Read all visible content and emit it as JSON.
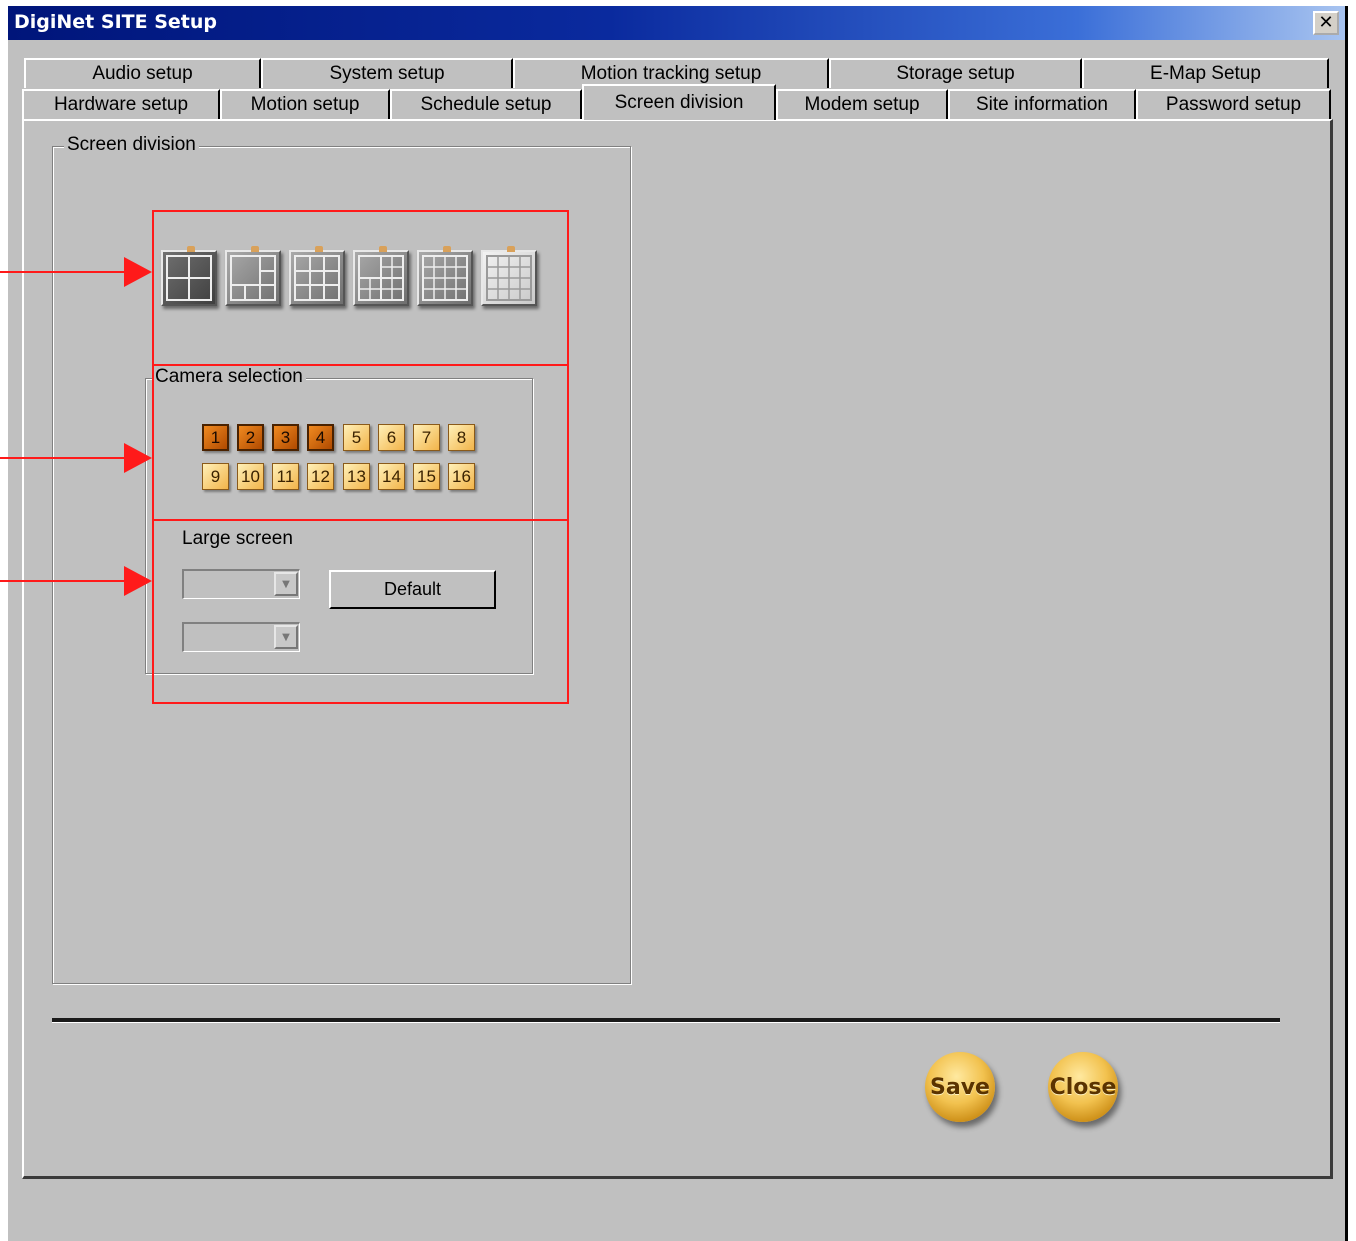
{
  "window": {
    "title": "DigiNet SITE Setup",
    "close_glyph": "✕"
  },
  "tabs_row1": [
    "Audio setup",
    "System setup",
    "Motion tracking setup",
    "Storage setup",
    "E-Map Setup"
  ],
  "tabs_row2": [
    "Hardware setup",
    "Motion setup",
    "Schedule setup",
    "Screen division",
    "Modem setup",
    "Site information",
    "Password setup"
  ],
  "active_tab": "Screen division",
  "screen_division": {
    "group_label": "Screen division",
    "layout_buttons": [
      "2x2",
      "1+5",
      "3x3",
      "1+12",
      "4x4-variant",
      "4x4"
    ],
    "selected_layout": "2x2"
  },
  "camera_selection": {
    "group_label": "Camera selection",
    "cameras": [
      "1",
      "2",
      "3",
      "4",
      "5",
      "6",
      "7",
      "8",
      "9",
      "10",
      "11",
      "12",
      "13",
      "14",
      "15",
      "16"
    ],
    "selected": [
      "1",
      "2",
      "3",
      "4"
    ]
  },
  "large_screen": {
    "label": "Large screen",
    "combo1_value": "",
    "combo2_value": "",
    "default_label": "Default"
  },
  "footer": {
    "save_label": "Save",
    "close_label": "Close"
  },
  "colors": {
    "annotation_red": "#ff1a1a",
    "titlebar_start": "#00157a",
    "titlebar_end": "#a8c4f0",
    "dialog_gray": "#c0c0c0",
    "camera_on": "#d0651a",
    "camera_off": "#f2b44a",
    "round_button_gold": "#f2c24f"
  }
}
